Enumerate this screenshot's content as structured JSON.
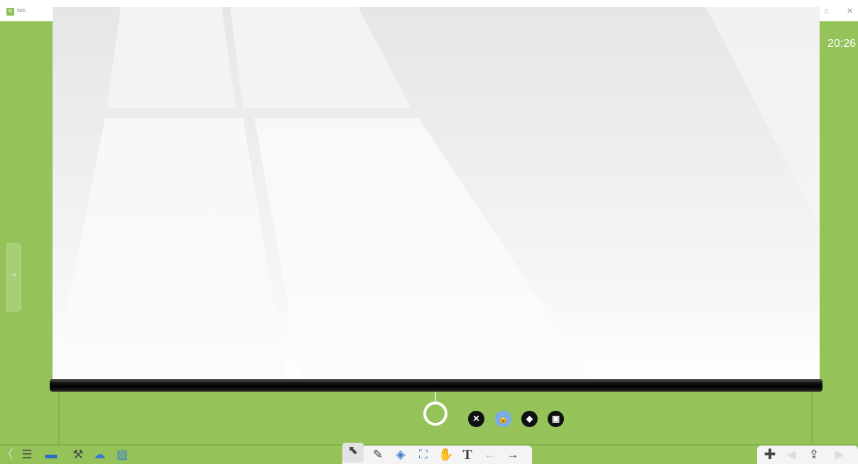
{
  "titlebar": {
    "app_name": "Not-",
    "logo_glyph": "N",
    "restore_glyph": "⌂",
    "close_glyph": "✕"
  },
  "clock": {
    "time": "20:26"
  },
  "side_handle": {
    "glyph": "⇒"
  },
  "screen_actions": [
    {
      "name": "close-action-button",
      "glyph": "✕",
      "style": "dark"
    },
    {
      "name": "lock-action-button",
      "glyph": "🔒",
      "style": "blue"
    },
    {
      "name": "erase-action-button",
      "glyph": "◆",
      "style": "dark"
    },
    {
      "name": "save-action-button",
      "glyph": "▣",
      "style": "dark"
    }
  ],
  "toolbar_left": {
    "prev": "〈",
    "menu": "☰",
    "board": "▬",
    "tools": "⚒",
    "cloud": "☁",
    "image": "▨"
  },
  "toolbar_center": {
    "select": "⬉",
    "pen": "✎",
    "eraser": "◈",
    "fill": "⛶",
    "hand": "✋",
    "text": "T",
    "undo": "←",
    "redo": "→"
  },
  "toolbar_right": {
    "add": "✚",
    "prev_page": "◀",
    "page": "⇪",
    "next_page": "▶"
  },
  "colors": {
    "background": "#95c35a",
    "accent_blue": "#7aa9f0"
  }
}
